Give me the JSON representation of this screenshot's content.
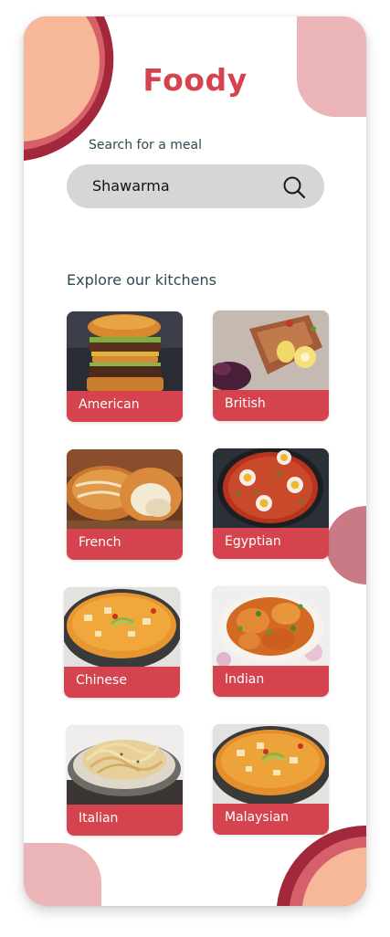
{
  "app": {
    "title": "Foody"
  },
  "search": {
    "label": "Search for a meal",
    "value": "Shawarma",
    "icon": "search-icon"
  },
  "kitchens": {
    "heading": "Explore our kitchens",
    "items": [
      {
        "label": "American"
      },
      {
        "label": "British"
      },
      {
        "label": "French"
      },
      {
        "label": "Egyptian"
      },
      {
        "label": "Chinese"
      },
      {
        "label": "Indian"
      },
      {
        "label": "Italian"
      },
      {
        "label": "Malaysian"
      }
    ]
  },
  "colors": {
    "accent": "#d5434f",
    "peach": "#f6b899",
    "pink": "#ebb5b8",
    "dark_red": "#a3283b",
    "text": "#2f4a52"
  }
}
